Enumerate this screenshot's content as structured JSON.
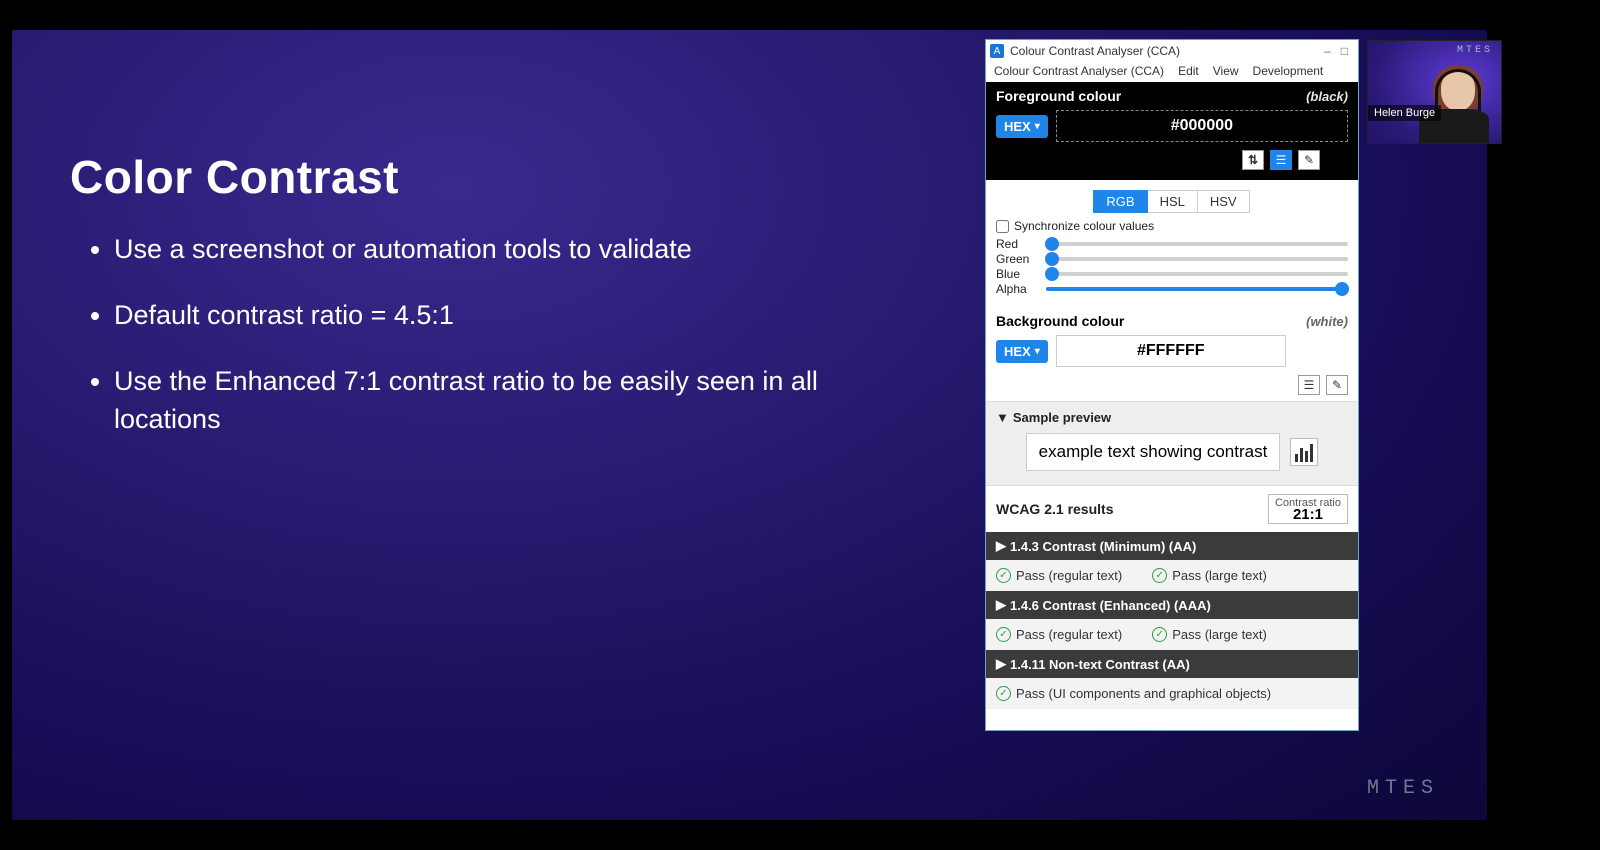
{
  "brand": "MTES",
  "slide": {
    "title": "Color Contrast",
    "bullets": [
      "Use a screenshot or automation tools to validate",
      "Default contrast ratio = 4.5:1",
      "Use the Enhanced 7:1 contrast ratio to be easily seen in all locations"
    ]
  },
  "webcam": {
    "name": "Helen Burge",
    "brand": "MTES"
  },
  "cca": {
    "titlebar": "Colour Contrast Analyser (CCA)",
    "win_buttons": {
      "min": "–",
      "max": "□",
      "close": ""
    },
    "menubar": [
      "Colour Contrast Analyser (CCA)",
      "Edit",
      "View",
      "Development"
    ],
    "fg": {
      "label": "Foreground colour",
      "hint": "(black)",
      "format": "HEX",
      "value": "#000000",
      "toolbar_icons": [
        "swap-icon",
        "sliders-icon",
        "eyedropper-icon",
        "expand-icon"
      ]
    },
    "model_tabs": [
      "RGB",
      "HSL",
      "HSV"
    ],
    "model_active": "RGB",
    "sync_label": "Synchronize colour values",
    "sliders": {
      "Red": {
        "value": 0,
        "max": 255
      },
      "Green": {
        "value": 0,
        "max": 255
      },
      "Blue": {
        "value": 0,
        "max": 255
      },
      "Alpha": {
        "value": 100,
        "max": 100
      }
    },
    "bg": {
      "label": "Background colour",
      "hint": "(white)",
      "format": "HEX",
      "value": "#FFFFFF",
      "toolbar_icons": [
        "sliders-icon",
        "eyedropper-icon"
      ]
    },
    "sample": {
      "title": "Sample preview",
      "text": "example text showing contrast"
    },
    "wcag": {
      "title": "WCAG 2.1 results",
      "ratio_label": "Contrast ratio",
      "ratio": "21:1",
      "criteria": [
        {
          "title": "1.4.3 Contrast (Minimum) (AA)",
          "passes": [
            "Pass (regular text)",
            "Pass (large text)"
          ]
        },
        {
          "title": "1.4.6 Contrast (Enhanced) (AAA)",
          "passes": [
            "Pass (regular text)",
            "Pass (large text)"
          ]
        },
        {
          "title": "1.4.11 Non-text Contrast (AA)",
          "passes": [
            "Pass (UI components and graphical objects)"
          ]
        }
      ]
    }
  },
  "colors": {
    "accent": "#1f85e8",
    "pass": "#2f9e44"
  }
}
